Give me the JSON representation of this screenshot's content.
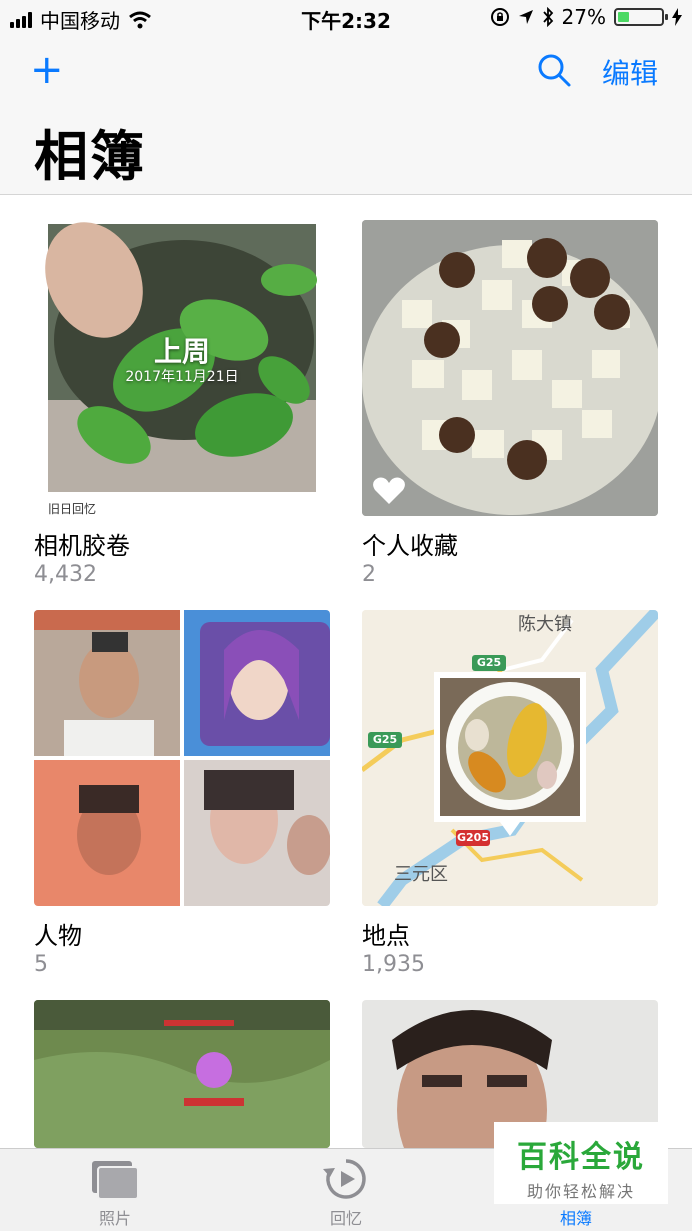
{
  "status": {
    "carrier": "中国移动",
    "time": "下午2:32",
    "battery": "27%",
    "battery_level": 0.27
  },
  "nav": {
    "add_icon": "+",
    "edit": "编辑",
    "title": "相簿"
  },
  "albums": [
    {
      "name": "相机胶卷",
      "count": "4,432",
      "memory_title": "上周",
      "memory_date": "2017年11月21日",
      "memory_caption": "旧日回忆"
    },
    {
      "name": "个人收藏",
      "count": "2"
    },
    {
      "name": "人物",
      "count": "5"
    },
    {
      "name": "地点",
      "count": "1,935",
      "map_labels": [
        "陈大镇",
        "三元区",
        "G25",
        "G25",
        "G205"
      ]
    }
  ],
  "tabs": [
    {
      "label": "照片"
    },
    {
      "label": "回忆"
    },
    {
      "label": "相簿"
    }
  ],
  "watermark": {
    "title": "百科全说",
    "subtitle": "助你轻松解决"
  },
  "colors": {
    "accent": "#0a7aff",
    "battery": "#4cd964",
    "watermark": "#2aa83a"
  }
}
